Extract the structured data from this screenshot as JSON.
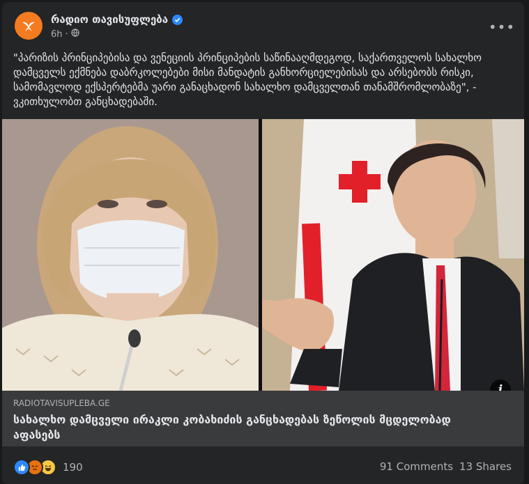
{
  "post": {
    "page_name": "რადიო თავისუფლება",
    "time": "6h",
    "privacy_icon": "globe-icon",
    "text": "\"პარიზის პრინციპებისა და ვენეციის პრინციპების საწინააღმდეგოდ, საქართველოს სახალხო დამცველს ექმნება დაბრკოლებები მისი მანდატის განხორციელებისას და არსებობს რისკი, სამომავლოდ ექსპერტებმა უარი განაცხადონ სახალხო დამცველთან თანამშრომლობაზე\", - ვკითხულობთ განცხადებაში.",
    "more_icon": "more-options-icon"
  },
  "link": {
    "domain": "RADIOTAVISUPLEBA.GE",
    "title": "სახალხო დამცველი ირაკლი კობახიძის განცხადებას ზეწოლის მცდელობად აფასებს",
    "info_icon": "info-icon"
  },
  "stats": {
    "reaction_icons": [
      "like-icon",
      "angry-icon",
      "haha-icon"
    ],
    "reaction_count": "190",
    "comments": "91 Comments",
    "shares": "13 Shares"
  },
  "colors": {
    "card_bg": "#242526",
    "link_bg": "#3a3b3c",
    "brand_orange": "#f47b20",
    "verified_blue": "#2d88ff"
  }
}
